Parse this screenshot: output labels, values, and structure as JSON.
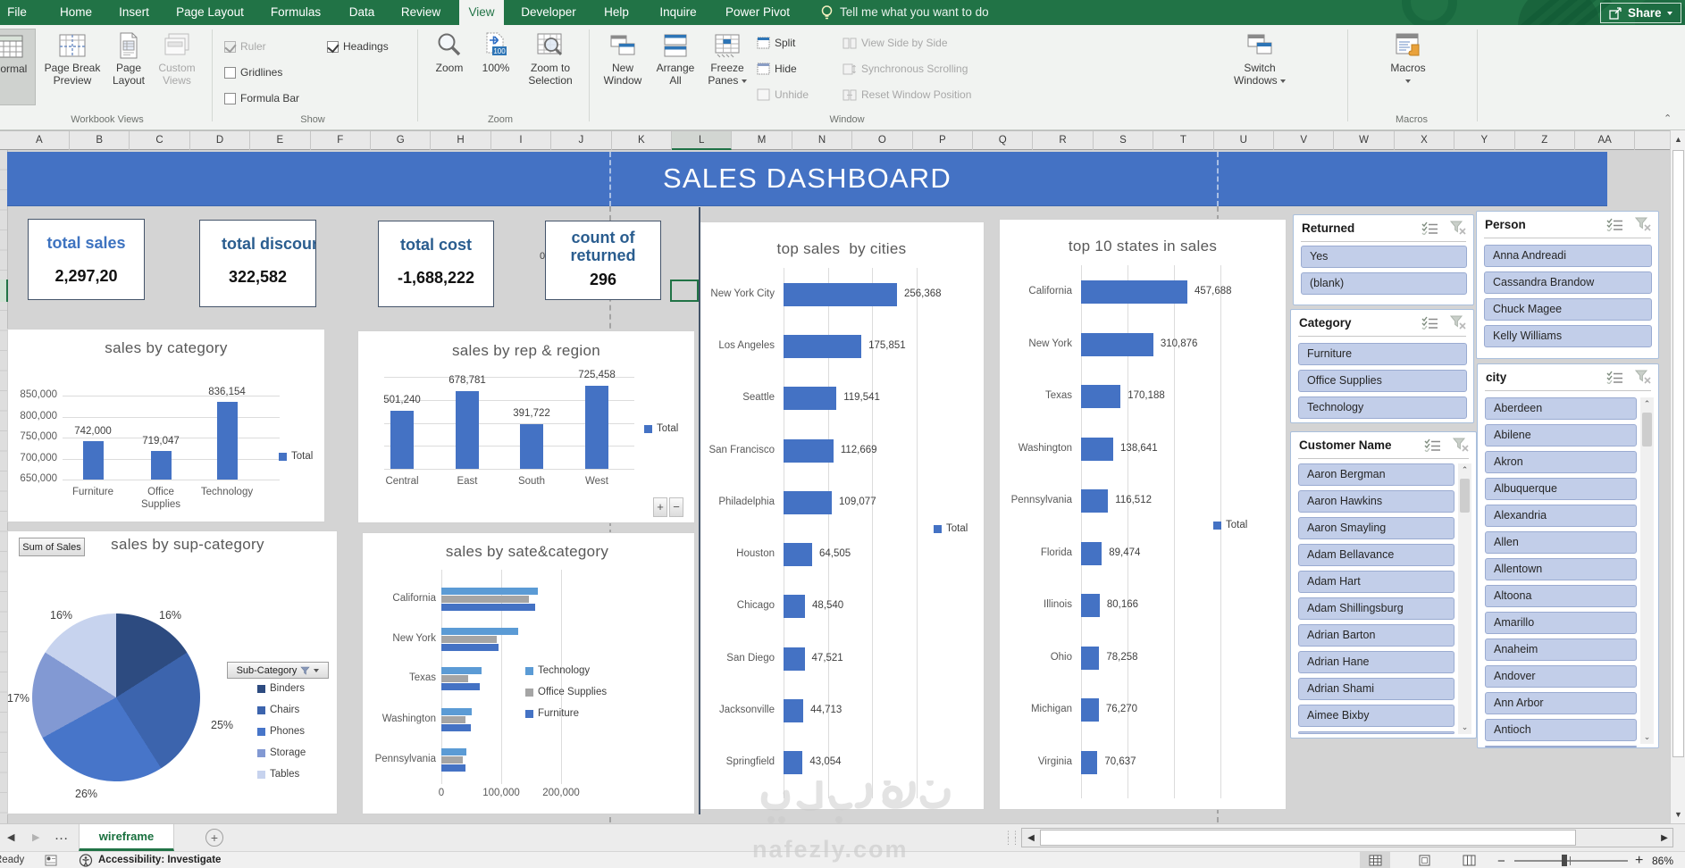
{
  "ribbon": {
    "tabs": [
      "File",
      "Home",
      "Insert",
      "Page Layout",
      "Formulas",
      "Data",
      "Review",
      "View",
      "Developer",
      "Help",
      "Inquire",
      "Power Pivot"
    ],
    "active_tab": "View",
    "tell_me": "Tell me what you want to do",
    "share_label": "Share",
    "workbook_views": {
      "group_label": "Workbook Views",
      "normal": "Normal",
      "page_break_preview": "Page Break Preview",
      "page_layout": "Page Layout",
      "custom_views": "Custom Views"
    },
    "show": {
      "group_label": "Show",
      "ruler": "Ruler",
      "gridlines": "Gridlines",
      "formula_bar": "Formula Bar",
      "headings": "Headings",
      "ruler_checked": true,
      "gridlines_checked": false,
      "formula_bar_checked": false,
      "headings_checked": true
    },
    "zoom": {
      "group_label": "Zoom",
      "zoom": "Zoom",
      "pct": "100%",
      "zoom_to_selection": "Zoom to Selection"
    },
    "window": {
      "group_label": "Window",
      "new_window": "New Window",
      "arrange_all": "Arrange All",
      "freeze_panes": "Freeze Panes",
      "split": "Split",
      "hide": "Hide",
      "unhide": "Unhide",
      "view_side_by_side": "View Side by Side",
      "synchronous_scrolling": "Synchronous Scrolling",
      "reset_window_position": "Reset Window Position",
      "switch_windows_1": "Switch",
      "switch_windows_2": "Windows"
    },
    "macros": {
      "group_label": "Macros",
      "macros": "Macros"
    }
  },
  "grid": {
    "columns": [
      "A",
      "B",
      "C",
      "D",
      "E",
      "F",
      "G",
      "H",
      "I",
      "J",
      "K",
      "L",
      "M",
      "N",
      "O",
      "P",
      "Q",
      "R",
      "S",
      "T",
      "U",
      "V",
      "W",
      "X",
      "Y",
      "Z",
      "AA"
    ],
    "selected_column": "L"
  },
  "dashboard": {
    "title": "SALES DASHBOARD",
    "kpis": [
      {
        "title": "total sales",
        "value": "2,297,20",
        "title_color": "#3e73c0"
      },
      {
        "title": "total discount",
        "value": "322,582",
        "title_color": "#2a5d8f"
      },
      {
        "title": "total cost",
        "value": "-1,688,222",
        "title_color": "#2a5d8f"
      },
      {
        "title": "count of returned",
        "value": "296",
        "title_color": "#2a5d8f"
      }
    ]
  },
  "chart_data": [
    {
      "id": "cat",
      "type": "bar",
      "title": "sales by category",
      "categories": [
        "Furniture",
        "Office Supplies",
        "Technology"
      ],
      "values": [
        742000,
        719047,
        836154
      ],
      "value_labels": [
        "742,000",
        "719,047",
        "836,154"
      ],
      "ylim": [
        650000,
        850000
      ],
      "yticks": [
        {
          "v": 850000,
          "label": "850,000"
        },
        {
          "v": 800000,
          "label": "800,000"
        },
        {
          "v": 750000,
          "label": "750,000"
        },
        {
          "v": 700000,
          "label": "700,000"
        },
        {
          "v": 650000,
          "label": "650,000"
        }
      ],
      "legend": "Total",
      "color": "#4472c4"
    },
    {
      "id": "rep",
      "type": "bar",
      "title": "sales by rep & region",
      "categories": [
        "Central",
        "East",
        "South",
        "West"
      ],
      "values": [
        501240,
        678781,
        391722,
        725458
      ],
      "value_labels": [
        "501,240",
        "678,781",
        "391,722",
        "725,458"
      ],
      "ylim": [
        0,
        800000
      ],
      "yticks": [],
      "legend": "Total",
      "color": "#4472c4",
      "plus_minus": [
        "+",
        "−"
      ]
    },
    {
      "id": "pie",
      "type": "pie",
      "title": "sales by sup-category",
      "field_button": "Sum of Sales",
      "filter_button": "Sub-Category",
      "slices": [
        {
          "label": "Binders",
          "pct": 16,
          "pct_label": "16%",
          "color": "#2d4b80"
        },
        {
          "label": "Chairs",
          "pct": 25,
          "pct_label": "25%",
          "color": "#3c64ad"
        },
        {
          "label": "Phones",
          "pct": 26,
          "pct_label": "26%",
          "color": "#4775c9"
        },
        {
          "label": "Storage",
          "pct": 17,
          "pct_label": "17%",
          "color": "#8299d3"
        },
        {
          "label": "Tables",
          "pct": 16,
          "pct_label": "16%",
          "color": "#c7d3ee"
        }
      ]
    },
    {
      "id": "statecat",
      "type": "hbar-multi",
      "title": "sales by sate&category",
      "categories": [
        "California",
        "New York",
        "Texas",
        "Washington",
        "Pennsylvania"
      ],
      "series": [
        {
          "name": "Technology",
          "color": "#5b9bd5",
          "values": [
            161000,
            128000,
            67000,
            51000,
            42000
          ]
        },
        {
          "name": "Office Supplies",
          "color": "#a5a5a5",
          "values": [
            146000,
            92000,
            45000,
            40000,
            36000
          ]
        },
        {
          "name": "Furniture",
          "color": "#4472c4",
          "values": [
            157000,
            95000,
            64000,
            49000,
            40000
          ]
        }
      ],
      "xticks": [
        {
          "v": 0,
          "label": "0"
        },
        {
          "v": 100000,
          "label": "100,000"
        },
        {
          "v": 200000,
          "label": "200,000"
        }
      ]
    },
    {
      "id": "cities",
      "type": "hbar",
      "title": "top sales  by cities",
      "categories": [
        "New York City",
        "Los Angeles",
        "Seattle",
        "San Francisco",
        "Philadelphia",
        "Houston",
        "Chicago",
        "San Diego",
        "Jacksonville",
        "Springfield"
      ],
      "values": [
        256368,
        175851,
        119541,
        112669,
        109077,
        64505,
        48540,
        47521,
        44713,
        43054
      ],
      "value_labels": [
        "256,368",
        "175,851",
        "119,541",
        "112,669",
        "109,077",
        "64,505",
        "48,540",
        "47,521",
        "44,713",
        "43,054"
      ],
      "legend": "Total",
      "color": "#4472c4"
    },
    {
      "id": "states",
      "type": "hbar",
      "title": "top 10 states in sales",
      "categories": [
        "California",
        "New York",
        "Texas",
        "Washington",
        "Pennsylvania",
        "Florida",
        "Illinois",
        "Ohio",
        "Michigan",
        "Virginia"
      ],
      "values": [
        457688,
        310876,
        170188,
        138641,
        116512,
        89474,
        80166,
        78258,
        76270,
        70637
      ],
      "value_labels": [
        "457,688",
        "310,876",
        "170,188",
        "138,641",
        "116,512",
        "89,474",
        "80,166",
        "78,258",
        "76,270",
        "70,637"
      ],
      "legend": "Total",
      "color": "#4472c4"
    }
  ],
  "slicers": [
    {
      "id": "returned",
      "title": "Returned",
      "items": [
        "Yes",
        "(blank)"
      ]
    },
    {
      "id": "category",
      "title": "Category",
      "items": [
        "Furniture",
        "Office Supplies",
        "Technology"
      ]
    },
    {
      "id": "customer",
      "title": "Customer Name",
      "items": [
        "Aaron Bergman",
        "Aaron Hawkins",
        "Aaron Smayling",
        "Adam Bellavance",
        "Adam Hart",
        "Adam Shillingsburg",
        "Adrian Barton",
        "Adrian Hane",
        "Adrian Shami",
        "Aimee Bixby"
      ]
    },
    {
      "id": "person",
      "title": "Person",
      "items": [
        "Anna Andreadi",
        "Cassandra Brandow",
        "Chuck Magee",
        "Kelly Williams"
      ]
    },
    {
      "id": "city",
      "title": "city",
      "items": [
        "Aberdeen",
        "Abilene",
        "Akron",
        "Albuquerque",
        "Alexandria",
        "Allen",
        "Allentown",
        "Altoona",
        "Amarillo",
        "Anaheim",
        "Andover",
        "Ann Arbor",
        "Antioch"
      ]
    }
  ],
  "sheet_tabs": {
    "active": "wireframe",
    "overflow": "...",
    "add": "+"
  },
  "status_bar": {
    "ready": "Ready",
    "accessibility": "Accessibility: Investigate",
    "zoom_level": "86%"
  },
  "watermark": {
    "text": "nafezly.com"
  }
}
